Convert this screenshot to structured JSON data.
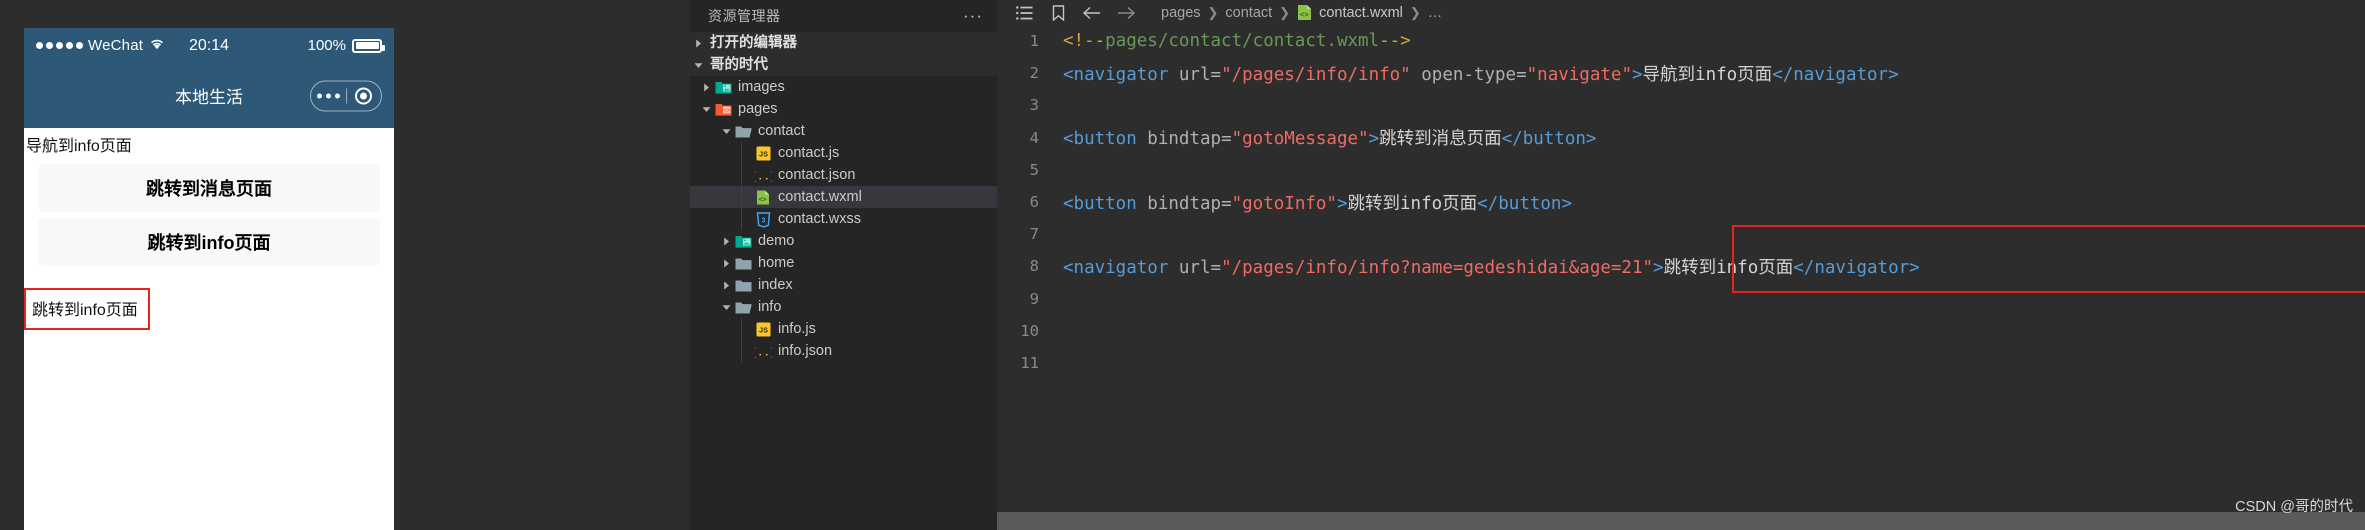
{
  "simulator": {
    "statusbar": {
      "carrier": "WeChat",
      "time": "20:14",
      "battery_pct": "100%"
    },
    "navbar": {
      "title": "本地生活"
    },
    "page": {
      "nav_link_top": "导航到info页面",
      "buttons": [
        "跳转到消息页面",
        "跳转到info页面"
      ],
      "nav_link_highlighted": "跳转到info页面"
    }
  },
  "explorer": {
    "header_title": "资源管理器",
    "more_glyph": "···",
    "sections": [
      {
        "label": "打开的编辑器",
        "expanded": false
      },
      {
        "label": "哥的时代",
        "expanded": true
      }
    ],
    "tree": [
      {
        "label": "images",
        "type": "folder-img",
        "depth": 1,
        "arrow": "right",
        "selected": false
      },
      {
        "label": "pages",
        "type": "folder-pages",
        "depth": 1,
        "arrow": "down",
        "selected": false
      },
      {
        "label": "contact",
        "type": "folder-open",
        "depth": 2,
        "arrow": "down",
        "selected": false
      },
      {
        "label": "contact.js",
        "type": "js",
        "depth": 3,
        "arrow": "none",
        "selected": false
      },
      {
        "label": "contact.json",
        "type": "json",
        "depth": 3,
        "arrow": "none",
        "selected": false
      },
      {
        "label": "contact.wxml",
        "type": "wxml",
        "depth": 3,
        "arrow": "none",
        "selected": true
      },
      {
        "label": "contact.wxss",
        "type": "wxss",
        "depth": 3,
        "arrow": "none",
        "selected": false
      },
      {
        "label": "demo",
        "type": "folder-img",
        "depth": 2,
        "arrow": "right",
        "selected": false
      },
      {
        "label": "home",
        "type": "folder",
        "depth": 2,
        "arrow": "right",
        "selected": false
      },
      {
        "label": "index",
        "type": "folder",
        "depth": 2,
        "arrow": "right",
        "selected": false
      },
      {
        "label": "info",
        "type": "folder-open",
        "depth": 2,
        "arrow": "down",
        "selected": false
      },
      {
        "label": "info.js",
        "type": "js",
        "depth": 3,
        "arrow": "none",
        "selected": false
      },
      {
        "label": "info.json",
        "type": "json",
        "depth": 3,
        "arrow": "none",
        "selected": false
      }
    ]
  },
  "editor": {
    "breadcrumb": {
      "path": [
        "pages",
        "contact"
      ],
      "file": "contact.wxml",
      "trailing": "…",
      "separator": "❯"
    },
    "line_numbers": [
      "1",
      "2",
      "3",
      "4",
      "5",
      "6",
      "7",
      "8",
      "9",
      "10",
      "11"
    ],
    "code_lines": [
      {
        "n": "1",
        "segments": [
          {
            "t": "cmtm",
            "s": "<!--"
          },
          {
            "t": "cmt",
            "s": "pages/contact/contact.wxml"
          },
          {
            "t": "cmtm",
            "s": "-->"
          }
        ]
      },
      {
        "n": "2",
        "segments": [
          {
            "t": "tag",
            "s": "<navigator"
          },
          {
            "t": "attr",
            "s": " url"
          },
          {
            "t": "eq",
            "s": "="
          },
          {
            "t": "str",
            "s": "\"/pages/info/info\""
          },
          {
            "t": "attr",
            "s": " open-type"
          },
          {
            "t": "eq",
            "s": "="
          },
          {
            "t": "str",
            "s": "\"navigate\""
          },
          {
            "t": "tag",
            "s": ">"
          },
          {
            "t": "txt",
            "s": "导航到info页面"
          },
          {
            "t": "tag",
            "s": "</navigator>"
          }
        ]
      },
      {
        "n": "3",
        "segments": []
      },
      {
        "n": "4",
        "segments": [
          {
            "t": "tag",
            "s": "<button"
          },
          {
            "t": "attr",
            "s": " bindtap"
          },
          {
            "t": "eq",
            "s": "="
          },
          {
            "t": "str",
            "s": "\"gotoMessage\""
          },
          {
            "t": "tag",
            "s": ">"
          },
          {
            "t": "txt",
            "s": "跳转到消息页面"
          },
          {
            "t": "tag",
            "s": "</button>"
          }
        ]
      },
      {
        "n": "5",
        "segments": []
      },
      {
        "n": "6",
        "segments": [
          {
            "t": "tag",
            "s": "<button"
          },
          {
            "t": "attr",
            "s": " bindtap"
          },
          {
            "t": "eq",
            "s": "="
          },
          {
            "t": "str",
            "s": "\"gotoInfo\""
          },
          {
            "t": "tag",
            "s": ">"
          },
          {
            "t": "txt",
            "s": "跳转到info页面"
          },
          {
            "t": "tag",
            "s": "</button>"
          }
        ]
      },
      {
        "n": "7",
        "segments": []
      },
      {
        "n": "8",
        "segments": [
          {
            "t": "tag",
            "s": "<navigator"
          },
          {
            "t": "attr",
            "s": " url"
          },
          {
            "t": "eq",
            "s": "="
          },
          {
            "t": "str",
            "s": "\"/pages/info/info?name=gedeshidai&age=21\""
          },
          {
            "t": "tag",
            "s": ">"
          },
          {
            "t": "txt",
            "s": "跳转到info页面"
          },
          {
            "t": "tag",
            "s": "</navigator>"
          }
        ]
      },
      {
        "n": "9",
        "segments": []
      },
      {
        "n": "10",
        "segments": []
      },
      {
        "n": "11",
        "segments": []
      }
    ]
  },
  "watermark": "CSDN @哥的时代",
  "colors": {
    "accent_red": "#e8221e",
    "navbar_blue": "#2e5878",
    "selected_row": "#37373d",
    "editor_bg": "#2d2d2d",
    "explorer_bg": "#252526"
  }
}
